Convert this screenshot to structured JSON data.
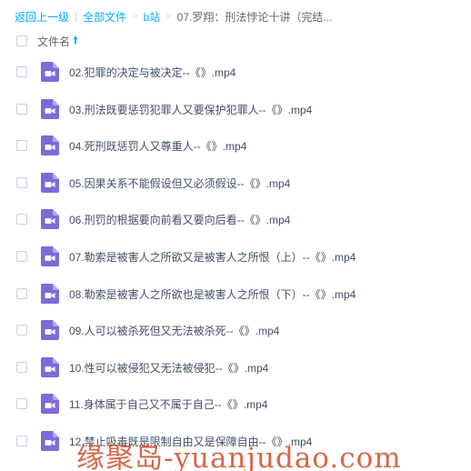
{
  "breadcrumb": {
    "back": "返回上一级",
    "separator": "|",
    "all_files": "全部文件",
    "gt": ">",
    "folder": "b站",
    "current": "07.罗翔：刑法悖论十讲（完结..."
  },
  "header": {
    "column_label": "文件名",
    "sort_icon": "arrow-up-icon"
  },
  "colors": {
    "link": "#09aaff",
    "video_icon": "#7b6bd8",
    "watermark": "#d65434"
  },
  "files": [
    {
      "name": "02.犯罪的决定与被决定--《》.mp4"
    },
    {
      "name": "03.刑法既要惩罚犯罪人又要保护犯罪人--《》.mp4"
    },
    {
      "name": "04.死刑既惩罚人又尊重人--《》.mp4"
    },
    {
      "name": "05.因果关系不能假设但又必须假设--《》.mp4"
    },
    {
      "name": "06.刑罚的根据要向前看又要向后看--《》.mp4"
    },
    {
      "name": "07.勒索是被害人之所欲又是被害人之所恨（上）--《》.mp4"
    },
    {
      "name": "08.勒索是被害人之所欲也是被害人之所恨（下）--《》.mp4"
    },
    {
      "name": "09.人可以被杀死但又无法被杀死--《》.mp4"
    },
    {
      "name": "10.性可以被侵犯又无法被侵犯--《》.mp4"
    },
    {
      "name": "11.身体属于自己又不属于自己--《》.mp4"
    },
    {
      "name": "12.禁止吸毒既是限制自由又是保障自由--《》.mp4"
    }
  ],
  "watermark": "缘聚岛-yuanjudao.com"
}
